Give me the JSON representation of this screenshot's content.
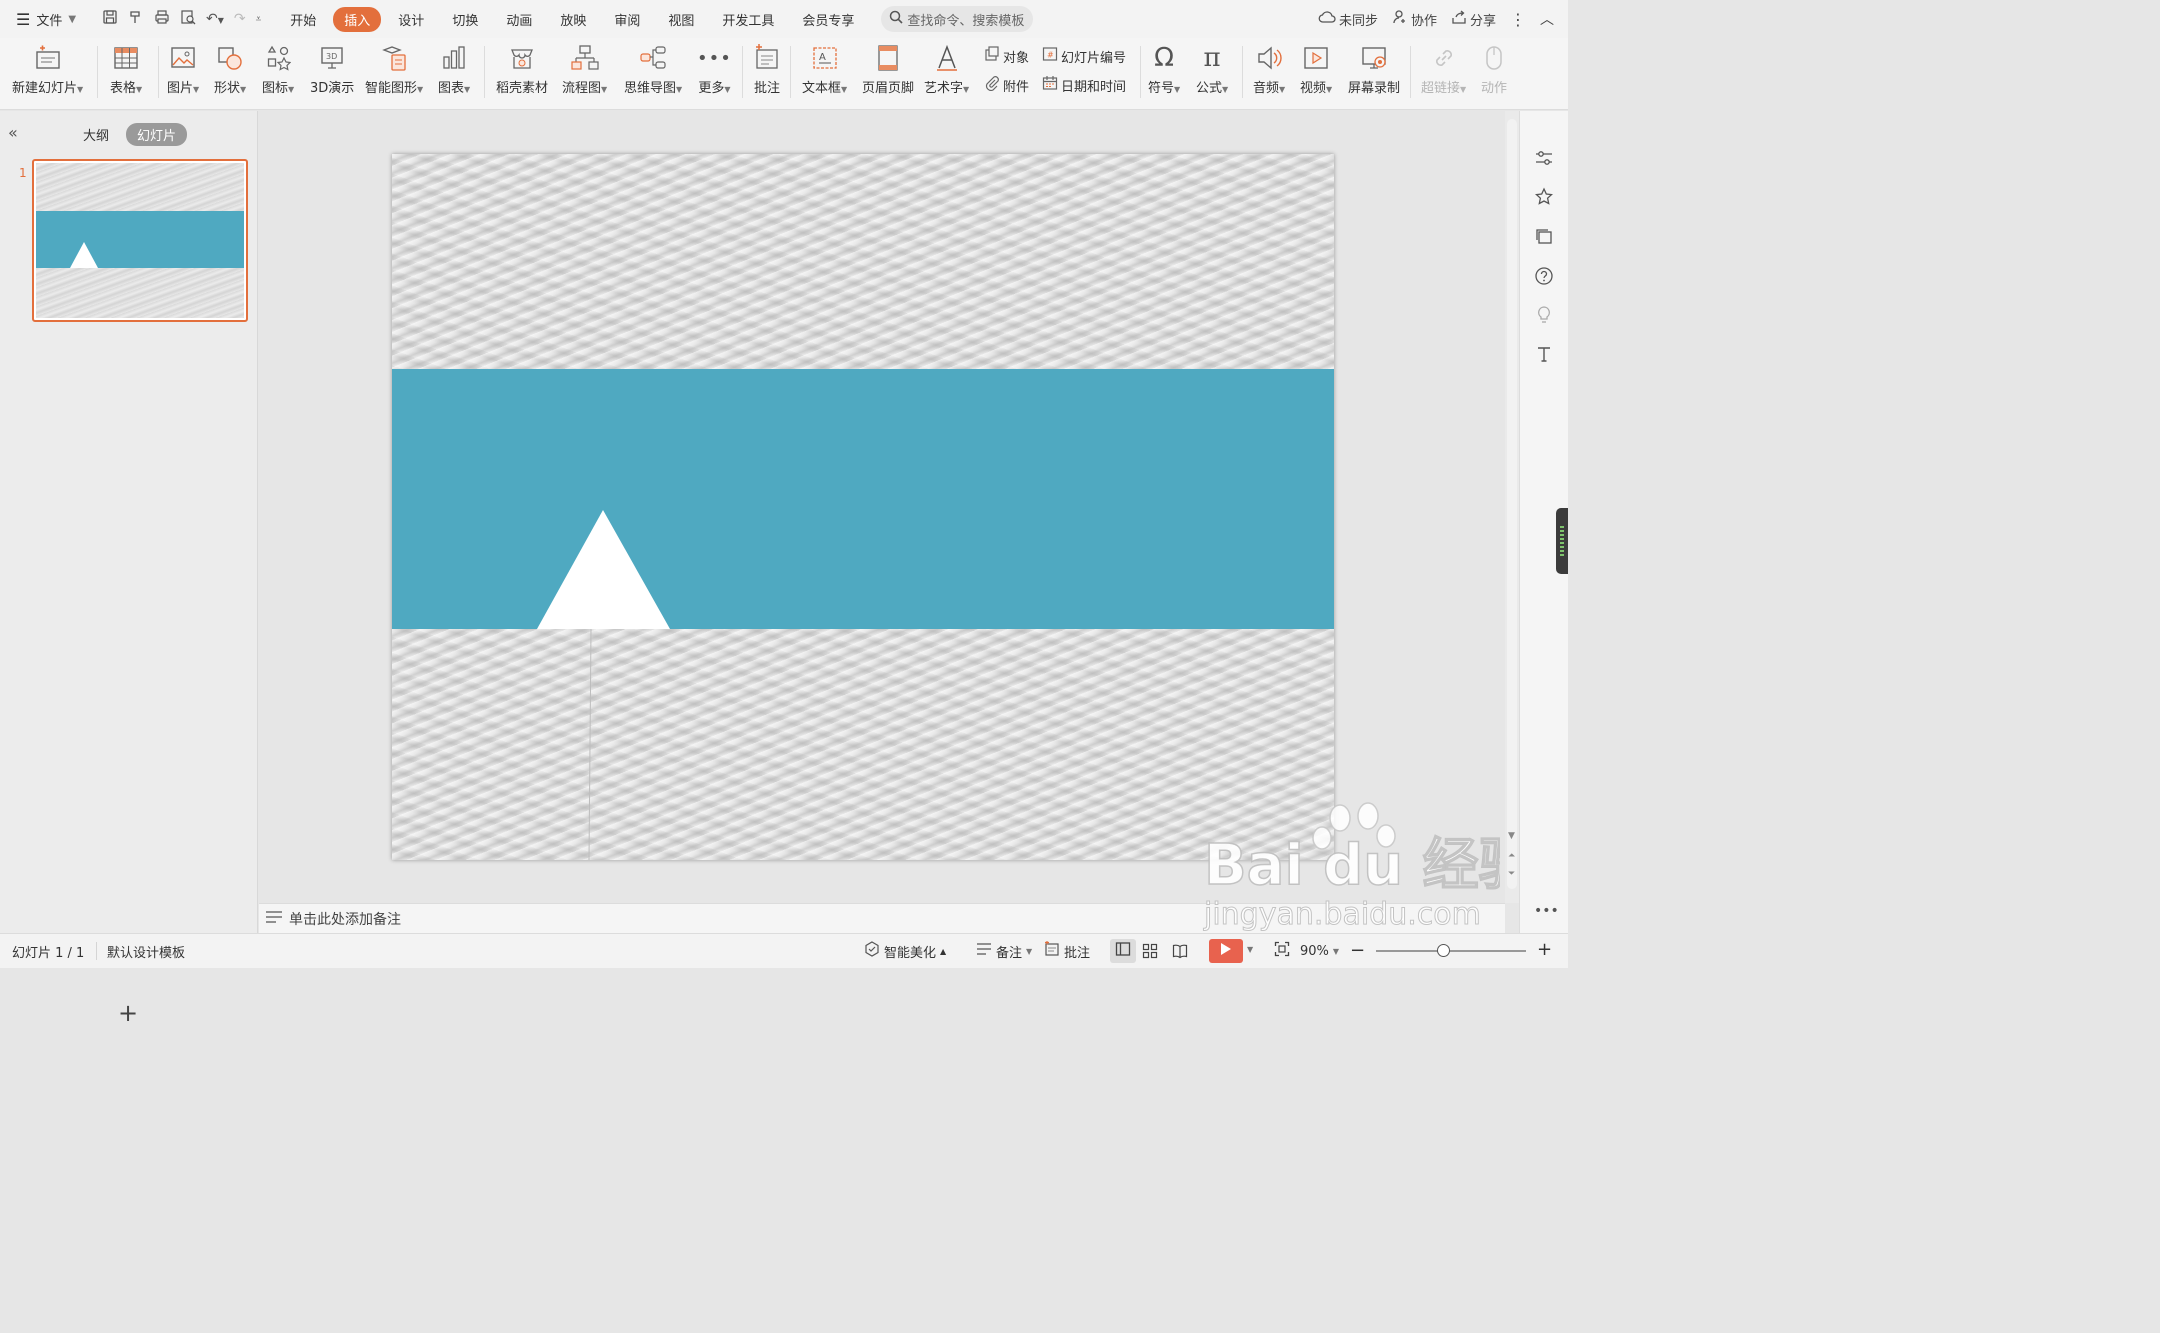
{
  "titlebar": {
    "file_label": "文件",
    "tabs": [
      {
        "label": "开始",
        "active": false
      },
      {
        "label": "插入",
        "active": true
      },
      {
        "label": "设计",
        "active": false
      },
      {
        "label": "切换",
        "active": false
      },
      {
        "label": "动画",
        "active": false
      },
      {
        "label": "放映",
        "active": false
      },
      {
        "label": "审阅",
        "active": false
      },
      {
        "label": "视图",
        "active": false
      },
      {
        "label": "开发工具",
        "active": false
      },
      {
        "label": "会员专享",
        "active": false
      }
    ],
    "search_placeholder": "查找命令、搜索模板",
    "sync_label": "未同步",
    "collab_label": "协作",
    "share_label": "分享"
  },
  "ribbon": {
    "new_slide": "新建幻灯片",
    "table": "表格",
    "picture": "图片",
    "shape": "形状",
    "icon": "图标",
    "demo3d": "3D演示",
    "smartart": "智能图形",
    "chart": "图表",
    "material": "稻壳素材",
    "flowchart": "流程图",
    "mindmap": "思维导图",
    "more": "更多",
    "comment": "批注",
    "textbox": "文本框",
    "header_footer": "页眉页脚",
    "wordart": "艺术字",
    "object": "对象",
    "slide_number": "幻灯片编号",
    "attachment": "附件",
    "datetime": "日期和时间",
    "symbol": "符号",
    "formula": "公式",
    "audio": "音频",
    "video": "视频",
    "screen_record": "屏幕录制",
    "hyperlink": "超链接",
    "action": "动作"
  },
  "left_panel": {
    "outline_tab": "大纲",
    "slides_tab": "幻灯片",
    "slide_number": "1"
  },
  "slide": {
    "band_color": "#4fa9c1",
    "triangle_color": "#ffffff"
  },
  "notes_placeholder": "单击此处添加备注",
  "status": {
    "slide_count": "幻灯片 1 / 1",
    "template": "默认设计模板",
    "beautify": "智能美化",
    "notes": "备注",
    "comment": "批注",
    "zoom": "90%",
    "zoom_fraction": 0.45
  },
  "watermark": {
    "brand": "Bai du 经验",
    "url": "jingyan.baidu.com"
  }
}
